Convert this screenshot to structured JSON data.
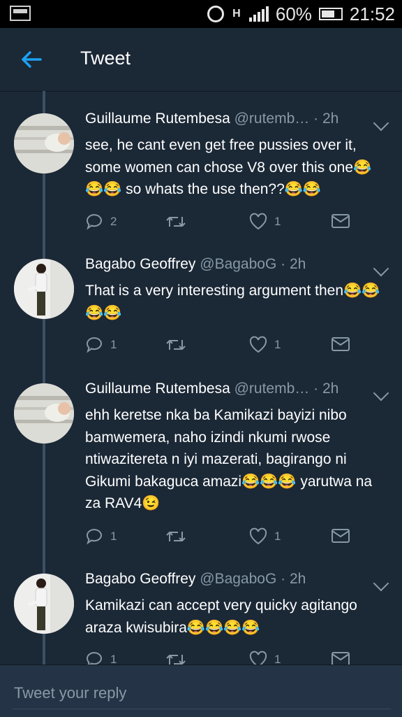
{
  "status_bar": {
    "battery": "60%",
    "time": "21:52",
    "network": "H"
  },
  "header": {
    "title": "Tweet"
  },
  "tweets": [
    {
      "name": "Guillaume Rutembesa",
      "handle": "@rutemb…",
      "time": "· 2h",
      "text": "see, he cant even get free pussies over it, some women can chose V8 over this one😂😂😂 so whats the use then??😂😂",
      "replies": "2",
      "retweets": "",
      "likes": "1"
    },
    {
      "name": "Bagabo Geoffrey",
      "handle": "@BagaboG",
      "time": "· 2h",
      "text": "That is a very interesting argument then😂😂😂😂",
      "replies": "1",
      "retweets": "",
      "likes": "1"
    },
    {
      "name": "Guillaume Rutembesa",
      "handle": "@rutemb…",
      "time": "· 2h",
      "text": "ehh keretse nka ba Kamikazi bayizi nibo bamwemera, naho izindi nkumi rwose ntiwazitereta n iyi mazerati, bagirango ni Gikumi bakaguca amazi😂😂😂 yarutwa na za RAV4😉",
      "replies": "1",
      "retweets": "",
      "likes": "1"
    },
    {
      "name": "Bagabo Geoffrey",
      "handle": "@BagaboG",
      "time": "· 2h",
      "text": "Kamikazi can accept very quicky agitango araza kwisubira😂😂😂😂",
      "replies": "1",
      "retweets": "",
      "likes": "1"
    }
  ],
  "composer": {
    "placeholder": "Tweet your reply"
  },
  "colors": {
    "background": "#1b2836",
    "accent": "#1da1f2",
    "muted": "#8899a6",
    "thread": "#3d4f63"
  }
}
